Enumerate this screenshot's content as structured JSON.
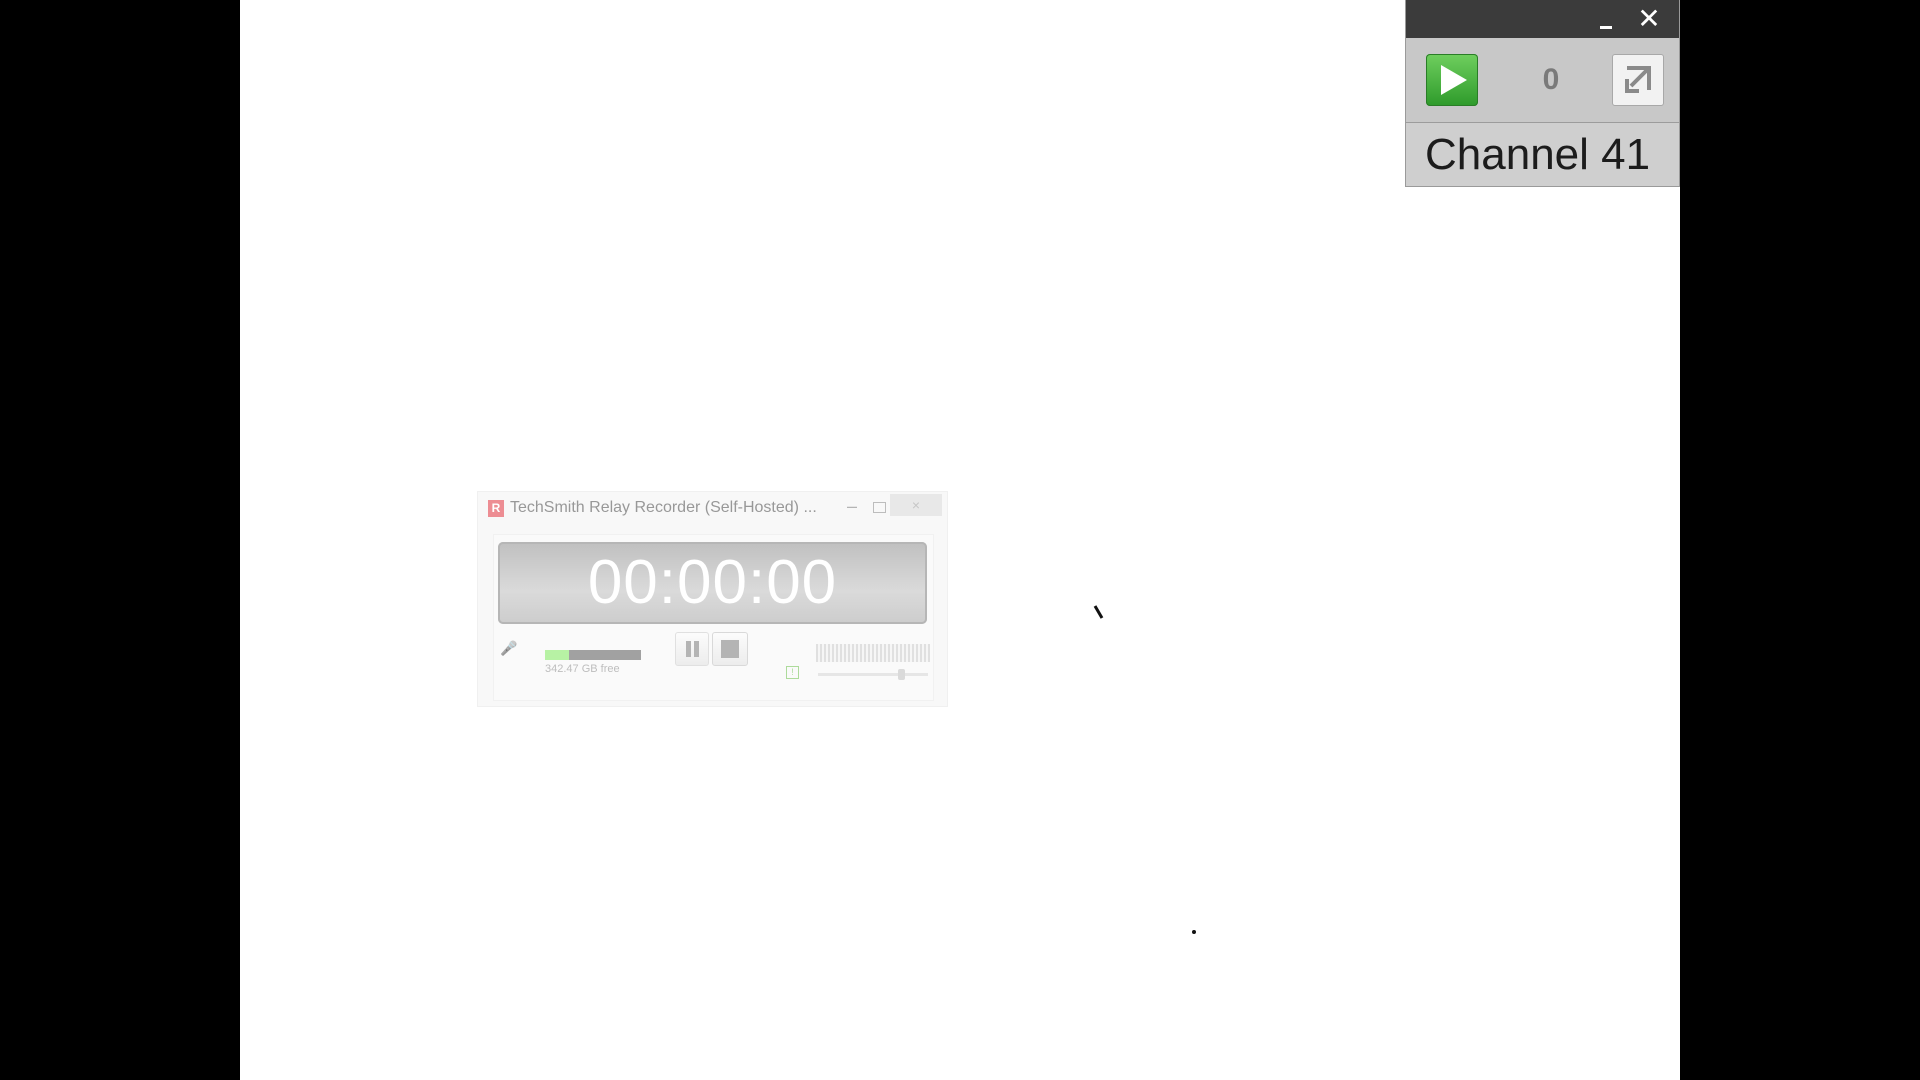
{
  "channel_widget": {
    "count": "0",
    "channel_name": "Channel 41",
    "close_glyph": "✕",
    "icons": {
      "play": "play-icon",
      "expand": "expand-icon",
      "minimize": "minimize-icon",
      "close": "close-icon"
    },
    "colors": {
      "titlebar": "#3b3b3b",
      "play_button": "#3fb537",
      "body": "#c9c9c9"
    }
  },
  "recorder": {
    "title": "TechSmith Relay Recorder (Self-Hosted) ...",
    "logo_letter": "R",
    "minimize_glyph": "–",
    "close_glyph": "×",
    "timer": "00:00:00",
    "disk_free": "342.47 GB free",
    "disk_used_fraction": 0.25,
    "volume_level": 0.75,
    "info_glyph": "!",
    "mic_glyph": "🎤",
    "icons": {
      "logo": "relay-logo-icon",
      "microphone": "microphone-icon",
      "pause": "pause-icon",
      "stop": "stop-icon",
      "info": "info-icon"
    }
  }
}
